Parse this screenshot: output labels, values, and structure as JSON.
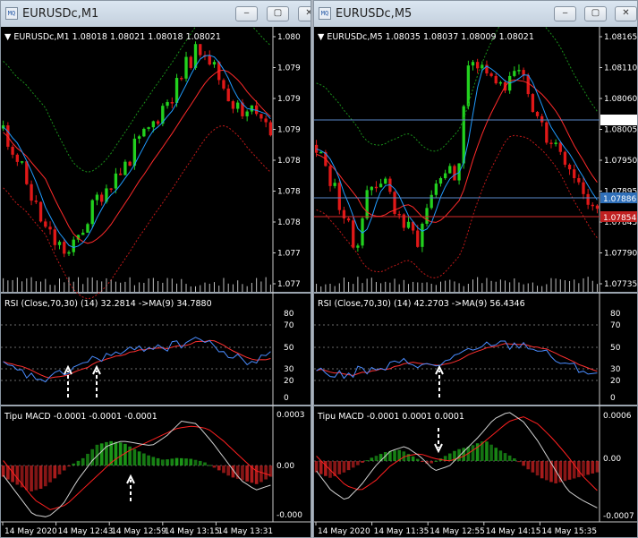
{
  "windows": [
    {
      "title": "EURUSDc,M1",
      "buttons": {
        "minimize": "‒",
        "maximize": "▢",
        "close": "✕"
      },
      "price_header": "▼ EURUSDc,M1  1.08018 1.08021 1.08018 1.08021",
      "price_axis": [
        "1.080",
        "1.079",
        "1.079",
        "1.079",
        "1.078",
        "1.078",
        "1.078",
        "1.077",
        "1.077"
      ],
      "rsi_header": "RSI (Close,70,30) (14) 32.2814  ->MA(9) 34.7880",
      "rsi_axis": [
        "80",
        "70",
        "50",
        "30",
        "20",
        "0"
      ],
      "macd_header": "Tipu MACD -0.0001 -0.0001 -0.0001",
      "macd_axis": [
        "0.0003",
        "0.00",
        "-0.000"
      ],
      "time_axis": [
        "14 May 2020",
        "14 May 12:43",
        "14 May 12:59",
        "14 May 13:15",
        "14 May 13:31"
      ]
    },
    {
      "title": "EURUSDc,M5",
      "buttons": {
        "minimize": "‒",
        "maximize": "▢",
        "close": "✕"
      },
      "price_header": "▼ EURUSDc,M5  1.08035 1.08037 1.08009 1.08021",
      "price_axis": [
        "1.08165",
        "1.08110",
        "1.08060",
        "1.08005",
        "1.07950",
        "1.07895",
        "1.07845",
        "1.07790",
        "1.07735"
      ],
      "price_tags": [
        "1.08021",
        "1.07886",
        "1.07854"
      ],
      "rsi_header": "RSI (Close,70,30) (14) 42.2703  ->MA(9) 56.4346",
      "rsi_axis": [
        "80",
        "70",
        "50",
        "30",
        "20",
        "0"
      ],
      "macd_header": "Tipu MACD -0.0001 0.0001 0.0001",
      "macd_axis": [
        "0.0006",
        "0.00",
        "-0.0007"
      ],
      "time_axis": [
        "14 May 2020",
        "14 May 11:35",
        "14 May 12:55",
        "14 May 14:15",
        "14 May 15:35"
      ]
    }
  ],
  "colors": {
    "bull": "#22d11e",
    "bear": "#e01818",
    "fast_ma": "#1f9bff",
    "slow_ma": "#ff2a2a",
    "band": "#1a8f1a",
    "band_red": "#c01818",
    "rsi_line": "#4a8cff",
    "rsi_ma": "#ff3030",
    "hist_green": "#23c21e",
    "hist_red": "#e02525",
    "macd_fast": "#d0d0d0",
    "macd_slow": "#ff2020",
    "arrow": "#ffffff",
    "hline_blue": "#5a87c8",
    "hline_red": "#d82a2a",
    "tag_blue": "#2f6fb8",
    "tag_red": "#c02020"
  }
}
